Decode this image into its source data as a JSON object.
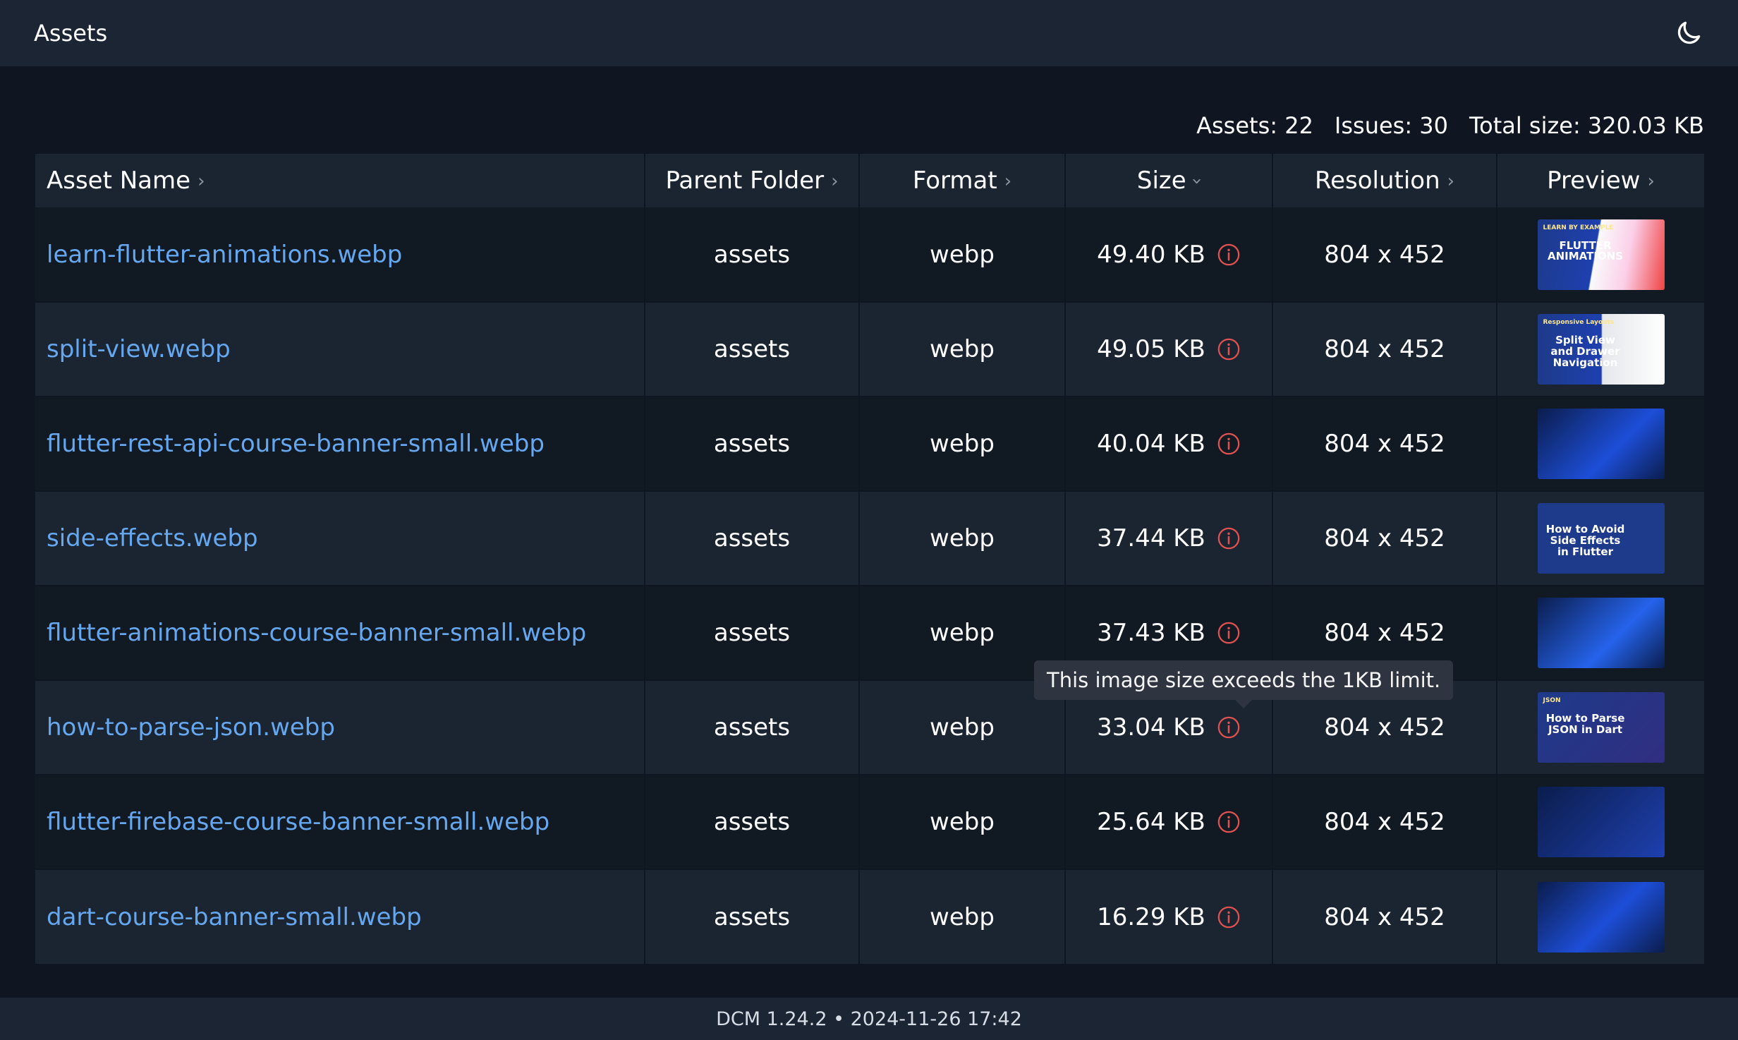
{
  "header": {
    "title": "Assets",
    "theme_toggle_icon": "moon-icon"
  },
  "summary": {
    "assets_label": "Assets: 22",
    "issues_label": "Issues: 30",
    "total_size_label": "Total size: 320.03 KB"
  },
  "table": {
    "columns": [
      "Asset Name",
      "Parent Folder",
      "Format",
      "Size",
      "Resolution",
      "Preview"
    ],
    "rows": [
      {
        "name": "learn-flutter-animations.webp",
        "folder": "assets",
        "format": "webp",
        "size": "49.40 KB",
        "resolution": "804 x 452",
        "preview_text": "FLUTTER ANIMATIONS",
        "preview_sub": "LEARN BY EXAMPLE"
      },
      {
        "name": "split-view.webp",
        "folder": "assets",
        "format": "webp",
        "size": "49.05 KB",
        "resolution": "804 x 452",
        "preview_text": "Split View and Drawer Navigation",
        "preview_sub": "Responsive Layouts"
      },
      {
        "name": "flutter-rest-api-course-banner-small.webp",
        "folder": "assets",
        "format": "webp",
        "size": "40.04 KB",
        "resolution": "804 x 452",
        "preview_text": "",
        "preview_sub": ""
      },
      {
        "name": "side-effects.webp",
        "folder": "assets",
        "format": "webp",
        "size": "37.44 KB",
        "resolution": "804 x 452",
        "preview_text": "How to Avoid Side Effects in Flutter",
        "preview_sub": ""
      },
      {
        "name": "flutter-animations-course-banner-small.webp",
        "folder": "assets",
        "format": "webp",
        "size": "37.43 KB",
        "resolution": "804 x 452",
        "preview_text": "",
        "preview_sub": ""
      },
      {
        "name": "how-to-parse-json.webp",
        "folder": "assets",
        "format": "webp",
        "size": "33.04 KB",
        "resolution": "804 x 452",
        "preview_text": "How to Parse JSON in Dart",
        "preview_sub": "JSON"
      },
      {
        "name": "flutter-firebase-course-banner-small.webp",
        "folder": "assets",
        "format": "webp",
        "size": "25.64 KB",
        "resolution": "804 x 452",
        "preview_text": "",
        "preview_sub": ""
      },
      {
        "name": "dart-course-banner-small.webp",
        "folder": "assets",
        "format": "webp",
        "size": "16.29 KB",
        "resolution": "804 x 452",
        "preview_text": "",
        "preview_sub": ""
      }
    ]
  },
  "tooltip": {
    "text": "This image size exceeds the 1KB limit."
  },
  "footer": {
    "text": "DCM 1.24.2 • 2024-11-26 17:42"
  },
  "colors": {
    "link": "#66a8f0",
    "warning": "#e0524f",
    "background": "#0f1621",
    "header_bar": "#1c2533"
  }
}
